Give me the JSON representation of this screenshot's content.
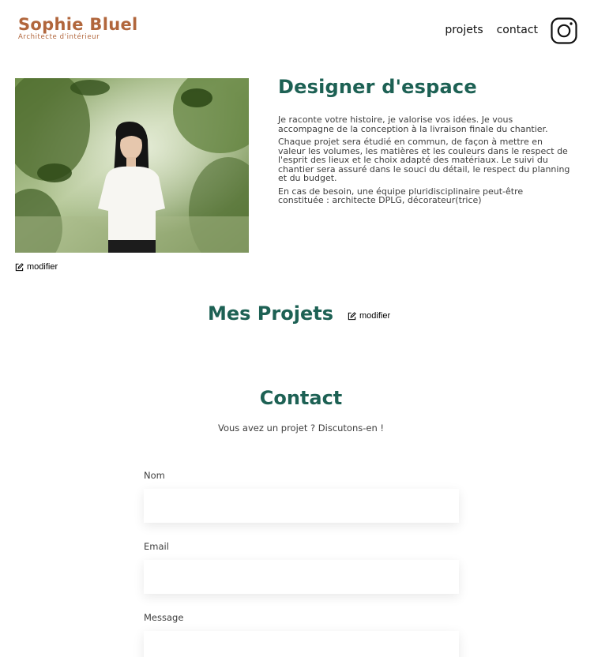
{
  "header": {
    "logo_name": "Sophie Bluel",
    "logo_subtitle": "Architecte d'intérieur",
    "nav": {
      "projects": "projets",
      "contact": "contact"
    },
    "instagram_icon": "instagram-icon"
  },
  "intro": {
    "photo": "portrait-photo",
    "edit_label": "modifier",
    "title": "Designer d'espace",
    "paragraphs": [
      "Je raconte votre histoire, je valorise vos idées. Je vous accompagne de la conception à la livraison finale du chantier.",
      "Chaque projet sera étudié en commun, de façon à mettre en valeur les volumes, les matières et les couleurs dans le respect de l'esprit des lieux et le choix adapté des matériaux. Le suivi du chantier sera assuré dans le souci du détail, le respect du planning et du budget.",
      "En cas de besoin, une équipe pluridisciplinaire peut-être constituée : architecte DPLG, décorateur(trice)"
    ]
  },
  "projects": {
    "title": "Mes Projets",
    "edit_label": "modifier"
  },
  "contact": {
    "title": "Contact",
    "subtitle": "Vous avez un projet ? Discutons-en !",
    "fields": {
      "name_label": "Nom",
      "name_value": "",
      "email_label": "Email",
      "email_value": "",
      "message_label": "Message",
      "message_value": ""
    }
  },
  "colors": {
    "brand": "#b1663c",
    "accent": "#1d6154",
    "text": "#3d3d3d"
  }
}
